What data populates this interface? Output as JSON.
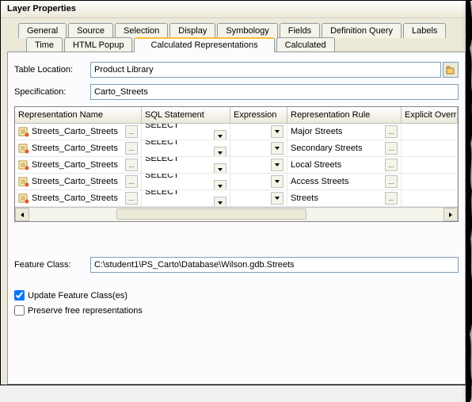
{
  "window": {
    "title": "Layer Properties"
  },
  "tabs_row1": [
    {
      "label": "General"
    },
    {
      "label": "Source"
    },
    {
      "label": "Selection"
    },
    {
      "label": "Display"
    },
    {
      "label": "Symbology"
    },
    {
      "label": "Fields"
    },
    {
      "label": "Definition Query"
    },
    {
      "label": "Labels"
    }
  ],
  "tabs_row2": [
    {
      "label": "Time"
    },
    {
      "label": "HTML Popup"
    },
    {
      "label": "Calculated Representations",
      "active": true
    },
    {
      "label": "Calculated"
    }
  ],
  "table_location": {
    "label": "Table Location:",
    "value": "Product Library"
  },
  "specification": {
    "label": "Specification:",
    "value": "Carto_Streets"
  },
  "grid": {
    "headers": [
      "Representation Name",
      "SQL Statement",
      "Expression",
      "Representation Rule",
      "Explicit Override"
    ],
    "rows": [
      {
        "name": "Streets_Carto_Streets",
        "sql": "SELECT <Target",
        "expr": "",
        "rule": "Major Streets"
      },
      {
        "name": "Streets_Carto_Streets",
        "sql": "SELECT <Target",
        "expr": "",
        "rule": "Secondary Streets"
      },
      {
        "name": "Streets_Carto_Streets",
        "sql": "SELECT <Target",
        "expr": "",
        "rule": "Local Streets"
      },
      {
        "name": "Streets_Carto_Streets",
        "sql": "SELECT <Target",
        "expr": "",
        "rule": "Access Streets"
      },
      {
        "name": "Streets_Carto_Streets",
        "sql": "SELECT <Target",
        "expr": "",
        "rule": "Streets"
      }
    ]
  },
  "feature_class": {
    "label": "Feature Class:",
    "value": "C:\\student1\\PS_Carto\\Database\\Wilson.gdb.Streets"
  },
  "check_update": {
    "label": "Update Feature Class(es)",
    "checked": true
  },
  "check_preserve": {
    "label": "Preserve free representations",
    "checked": false
  }
}
